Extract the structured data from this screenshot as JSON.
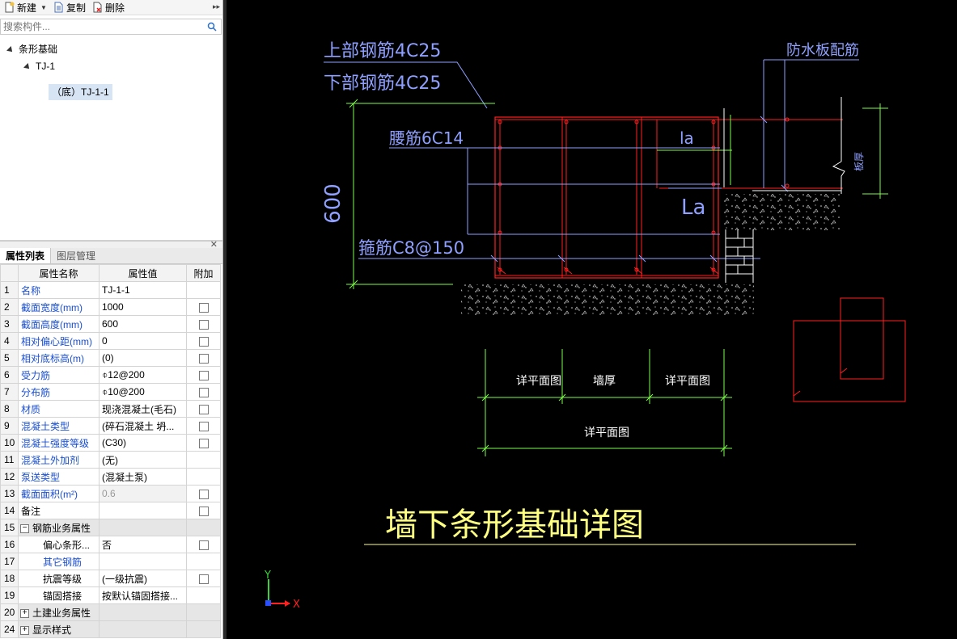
{
  "toolbar": {
    "new_label": "新建",
    "copy_label": "复制",
    "delete_label": "删除"
  },
  "search": {
    "placeholder": "搜索构件..."
  },
  "tree": {
    "root": "条形基础",
    "child": "TJ-1",
    "leaf": "（底）TJ-1-1"
  },
  "panel_tabs": {
    "properties": "属性列表",
    "layers": "图层管理"
  },
  "table": {
    "headers": {
      "name": "属性名称",
      "value": "属性值",
      "extra": "附加"
    },
    "rows": [
      {
        "n": "1",
        "name": "名称",
        "value": "TJ-1-1"
      },
      {
        "n": "2",
        "name": "截面宽度(mm)",
        "value": "1000"
      },
      {
        "n": "3",
        "name": "截面高度(mm)",
        "value": "600"
      },
      {
        "n": "4",
        "name": "相对偏心距(mm)",
        "value": "0"
      },
      {
        "n": "5",
        "name": "相对底标高(m)",
        "value": "(0)"
      },
      {
        "n": "6",
        "name": "受力筋",
        "value": "⌽12@200"
      },
      {
        "n": "7",
        "name": "分布筋",
        "value": "⌽10@200"
      },
      {
        "n": "8",
        "name": "材质",
        "value": "现浇混凝土(毛石)"
      },
      {
        "n": "9",
        "name": "混凝土类型",
        "value": "(碎石混凝土 坍..."
      },
      {
        "n": "10",
        "name": "混凝土强度等级",
        "value": "(C30)"
      },
      {
        "n": "11",
        "name": "混凝土外加剂",
        "value": "(无)"
      },
      {
        "n": "12",
        "name": "泵送类型",
        "value": "(混凝土泵)"
      },
      {
        "n": "13",
        "name": "截面面积(m²)",
        "value": "0.6"
      },
      {
        "n": "14",
        "name": "备注",
        "value": ""
      },
      {
        "n": "15",
        "name": "钢筋业务属性",
        "value": ""
      },
      {
        "n": "16",
        "name": "偏心条形...",
        "value": "否"
      },
      {
        "n": "17",
        "name": "其它钢筋",
        "value": ""
      },
      {
        "n": "18",
        "name": "抗震等级",
        "value": "(一级抗震)"
      },
      {
        "n": "19",
        "name": "锚固搭接",
        "value": "按默认锚固搭接..."
      },
      {
        "n": "20",
        "name": "土建业务属性",
        "value": ""
      },
      {
        "n": "24",
        "name": "显示样式",
        "value": ""
      }
    ]
  },
  "drawing": {
    "top_rebar": "上部钢筋4C25",
    "bottom_rebar": "下部钢筋4C25",
    "waist_rebar": "腰筋6C14",
    "stirrup": "箍筋C8@150",
    "height_dim": "600",
    "la_small": "la",
    "la_large": "La",
    "waterproof": "防水板配筋",
    "slab_thickness": "板厚",
    "dim_left": "详平面图",
    "dim_mid": "墙厚",
    "dim_right": "详平面图",
    "dim_total": "详平面图",
    "title": "墙下条形基础详图",
    "axis_x": "X",
    "axis_y": "Y"
  },
  "colors": {
    "cad_bg": "#000000",
    "rebar": "#ff2020",
    "dim": "#7cfc4a",
    "text": "#8fa0ff",
    "title": "#ffff80"
  }
}
